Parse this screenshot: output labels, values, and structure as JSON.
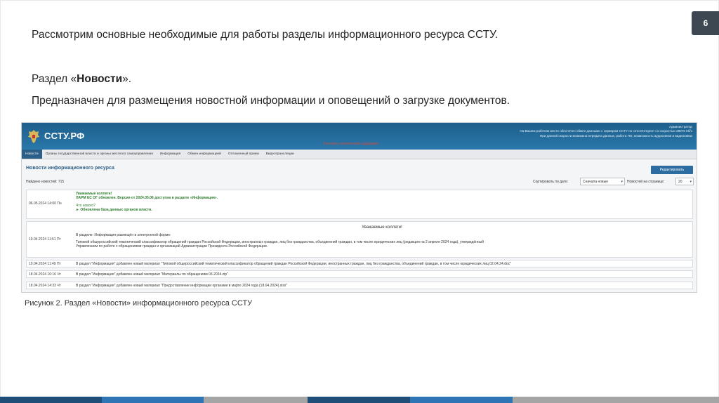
{
  "slide": {
    "page_number": "6",
    "line1": "Рассмотрим основные необходимые для работы разделы информационного ресурса ССТУ.",
    "line2_prefix": "Раздел «",
    "line2_bold": "Новости",
    "line2_suffix": "».",
    "line3": "Предназначен для размещения новостной информации и оповещений о загрузке документов.",
    "caption": "Рисунок 2. Раздел «Новости» информационного ресурса ССТУ"
  },
  "site": {
    "logo_text": "ССТУ.РФ",
    "header_right": [
      "Администратор",
      "На Вашем рабочем месте обеспечен обмен данными с сервером ССТУ по сети Интернет со скоростью 28076 Кб/с",
      "При данной скорости возможна передача данных, работа ПО, возможность аудиосвязи и видеосвязи"
    ],
    "header_warning": "Контакты технической поддержки",
    "nav": [
      "Новости",
      "Органы государственной власти и органы местного самоуправления",
      "Информация",
      "Обмен информацией",
      "Отложенный прием",
      "Видеотрансляции"
    ],
    "section_title": "Новости информационного ресурса",
    "edit_button": "Редактировать",
    "found_label": "Найдено новостей: 715",
    "sort_label": "Сортировать по дате:",
    "sort_value": "Сначала новые",
    "per_page_label": "Новостей на странице:",
    "per_page_value": "20",
    "news": [
      {
        "date": "06.05.2024 14:00 Пн",
        "lines": [
          "Уважаемые коллеги!",
          "ЛАРМ ЕС ОГ обновлен. Версия от 2024.05.06 доступна в разделе «Информация».",
          "",
          "Что нового?",
          "► Обновлена база данных органов власти."
        ]
      },
      {
        "date": "19.04.2024 11:51 Пт",
        "title": "Уважаемые коллеги!",
        "lines": [
          "В разделе: Информация размещён в электронной форме:",
          "Типовой общероссийский тематический классификатор обращений граждан Российской Федерации, иностранных граждан, лиц без гражданства, объединений граждан, в том числе юридических лиц (редакция на 2 апреля 2024 года), утверждённый",
          "Управлением по работе с обращениями граждан и организаций Администрации Президента Российской Федерации."
        ]
      },
      {
        "date": "19.04.2024 11:49 Пт",
        "text": "В раздел \"Информация\" добавлен новый материал \"Типовой общероссийский тематический классификатор обращений граждан Российской Федерации, иностранных граждан, лиц без гражданства, объединений граждан, в том числе юридических лиц 02.04.24.doc\""
      },
      {
        "date": "18.04.2024 16:16 Чт",
        "text": "В раздел \"Информация\" добавлен новый материал \"Материалы по обращениям 03.2024.zip\""
      },
      {
        "date": "18.04.2024 14:33 Чт",
        "text": "В раздел \"Информация\" добавлен новый материал \"Предоставление информации органами в марте 2024 года (18.04.2024).xlsx\""
      }
    ]
  },
  "colors": {
    "header_blue": "#2a78aa",
    "accent_green": "#2d7d2d",
    "page_badge": "#3d4852",
    "bottom_bar": [
      "#1f4e79",
      "#2e75b6",
      "#a5a5a5",
      "#1f4e79",
      "#2e75b6",
      "#a5a5a5"
    ]
  }
}
